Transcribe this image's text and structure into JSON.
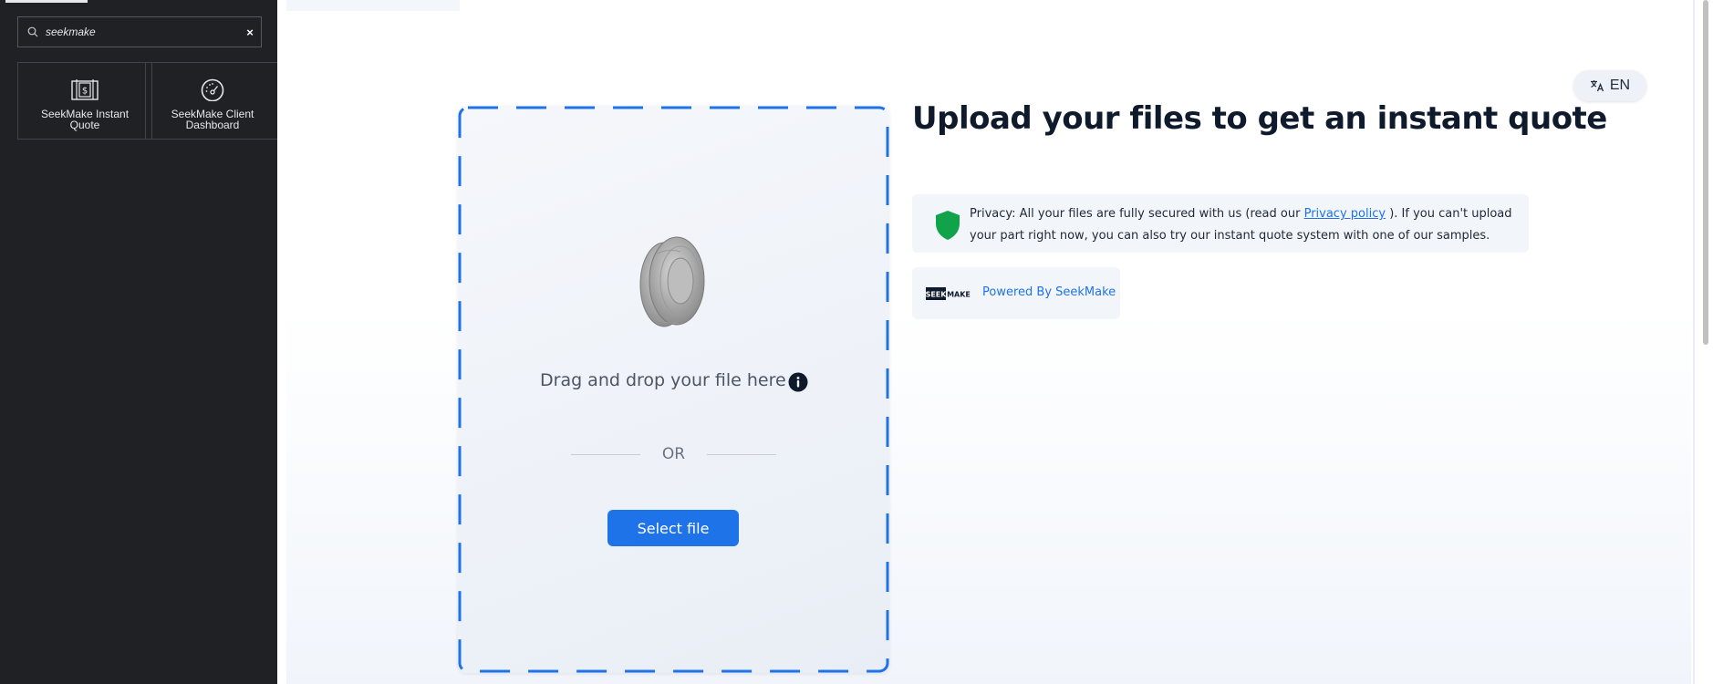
{
  "panel": {
    "search": {
      "value": "seekmake",
      "clear_glyph": "×"
    },
    "widgets": [
      {
        "label": "SeekMake Instant Quote",
        "icon": "instant-quote-icon"
      },
      {
        "label": "SeekMake Client Dashboard",
        "icon": "dashboard-gauge-icon"
      }
    ],
    "collapse_glyph": "‹"
  },
  "page": {
    "language": {
      "code": "EN",
      "icon": "translate-icon"
    },
    "upload": {
      "drop_text": "Drag and drop your file here",
      "or_text": "OR",
      "select_label": "Select file"
    },
    "heading": "Upload your files to get an instant quote",
    "privacy": {
      "text_before": "Privacy: All your files are fully secured with us (read our ",
      "link": "Privacy policy",
      "text_after": " ). If you can't upload your part right now, you can also try our instant quote system with one of our samples."
    },
    "powered": {
      "logo_text": "SEEKMAKE",
      "label": "Powered By SeekMake"
    }
  },
  "colors": {
    "accent": "#1f73e8",
    "shield": "#10a34a",
    "panel_bg": "#1f2124",
    "heading": "#0f1b2d"
  }
}
